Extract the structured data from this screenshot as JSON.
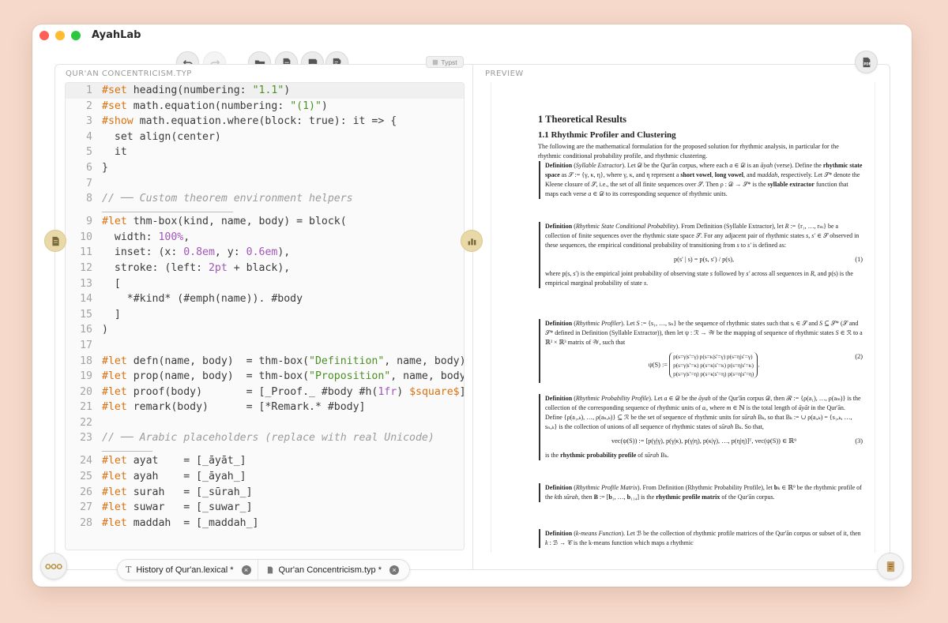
{
  "app": {
    "title": "AyahLab"
  },
  "toolbar": {
    "badge": "Typst"
  },
  "editor": {
    "label": "QUR'AN CONCENTRICISM.TYP",
    "lines": [
      {
        "n": "1",
        "code": [
          [
            "kw",
            "#set"
          ],
          [
            "",
            "heading(numbering: "
          ],
          [
            "str",
            "\"1.1\""
          ],
          [
            "",
            ")"
          ]
        ]
      },
      {
        "n": "2",
        "code": [
          [
            "kw",
            "#set"
          ],
          [
            "",
            "math.equation(numbering: "
          ],
          [
            "str",
            "\"(1)\""
          ],
          [
            "",
            ")"
          ]
        ]
      },
      {
        "n": "3",
        "code": [
          [
            "kw",
            "#show"
          ],
          [
            "",
            "math.equation.where(block: true): it => {"
          ]
        ]
      },
      {
        "n": "4",
        "code": [
          [
            "",
            "  set align(center)"
          ]
        ]
      },
      {
        "n": "5",
        "code": [
          [
            "",
            "  it"
          ]
        ]
      },
      {
        "n": "6",
        "code": [
          [
            "",
            "}"
          ]
        ]
      },
      {
        "n": "7",
        "code": []
      },
      {
        "n": "8",
        "code": [
          [
            "cmt",
            "// ── Custom theorem environment helpers"
          ]
        ],
        "rule": 166
      },
      {
        "n": "9",
        "code": [
          [
            "kw",
            "#let"
          ],
          [
            "",
            "thm-box(kind, name, body) = block("
          ]
        ]
      },
      {
        "n": "10",
        "code": [
          [
            "",
            "  width: "
          ],
          [
            "num",
            "100%"
          ],
          [
            "",
            ","
          ]
        ]
      },
      {
        "n": "11",
        "code": [
          [
            "",
            "  inset: (x: "
          ],
          [
            "num",
            "0.8em"
          ],
          [
            "",
            ", y: "
          ],
          [
            "num",
            "0.6em"
          ],
          [
            "",
            "),"
          ]
        ]
      },
      {
        "n": "12",
        "code": [
          [
            "",
            "  stroke: (left: "
          ],
          [
            "num",
            "2pt"
          ],
          [
            "",
            " + black),"
          ]
        ]
      },
      {
        "n": "13",
        "code": [
          [
            "",
            "  ["
          ]
        ]
      },
      {
        "n": "14",
        "code": [
          [
            "",
            "    *#kind* (#emph(name)). #body"
          ]
        ]
      },
      {
        "n": "15",
        "code": [
          [
            "",
            "  ]"
          ]
        ]
      },
      {
        "n": "16",
        "code": [
          [
            "",
            ")"
          ]
        ]
      },
      {
        "n": "17",
        "code": []
      },
      {
        "n": "18",
        "code": [
          [
            "kw",
            "#let"
          ],
          [
            "",
            "defn(name, body)  = thm-box("
          ],
          [
            "str",
            "\"Definition\""
          ],
          [
            "",
            ", name, body)"
          ]
        ]
      },
      {
        "n": "19",
        "code": [
          [
            "kw",
            "#let"
          ],
          [
            "",
            "prop(name, body)  = thm-box("
          ],
          [
            "str",
            "\"Proposition\""
          ],
          [
            "",
            ", name, body)"
          ]
        ]
      },
      {
        "n": "20",
        "code": [
          [
            "kw",
            "#let"
          ],
          [
            "",
            "proof(body)       = [_Proof._ #body #h("
          ],
          [
            "num",
            "1fr"
          ],
          [
            "",
            ") "
          ],
          [
            "kw",
            "$square$"
          ],
          [
            "",
            "]"
          ]
        ]
      },
      {
        "n": "21",
        "code": [
          [
            "kw",
            "#let"
          ],
          [
            "",
            "remark(body)      = [*Remark.* #body]"
          ]
        ]
      },
      {
        "n": "22",
        "code": []
      },
      {
        "n": "23",
        "code": [
          [
            "cmt",
            "// ── Arabic placeholders (replace with real Unicode)"
          ]
        ],
        "rule": 64
      },
      {
        "n": "24",
        "code": [
          [
            "kw",
            "#let"
          ],
          [
            "",
            "ayat    = [_āyāt_]"
          ]
        ]
      },
      {
        "n": "25",
        "code": [
          [
            "kw",
            "#let"
          ],
          [
            "",
            "ayah    = [_āyah_]"
          ]
        ]
      },
      {
        "n": "26",
        "code": [
          [
            "kw",
            "#let"
          ],
          [
            "",
            "surah   = [_sūrah_]"
          ]
        ]
      },
      {
        "n": "27",
        "code": [
          [
            "kw",
            "#let"
          ],
          [
            "",
            "suwar   = [_suwar_]"
          ]
        ]
      },
      {
        "n": "28",
        "code": [
          [
            "kw",
            "#let"
          ],
          [
            "",
            "maddah  = [_maddah_]"
          ]
        ]
      }
    ]
  },
  "preview": {
    "label": "PREVIEW",
    "h1": "1 Theoretical Results",
    "h2": "1.1 Rhythmic Profiler and Clustering",
    "intro": "The following are the mathematical formulation for the proposed solution for rhythmic analysis, in particular for the rhythmic conditional probability profile, and rhythmic clustering.",
    "d1": {
      "kind": "Definition",
      "name": "Syllable Extractor"
    },
    "d2": {
      "kind": "Definition",
      "name": "Rhythmic State Conditional Probability"
    },
    "d3": {
      "kind": "Definition",
      "name": "Rhythmic Profiler"
    },
    "d4": {
      "kind": "Definition",
      "name": "Rhythmic Probability Profile"
    },
    "d5": {
      "kind": "Definition",
      "name": "Rhythmic Profile Matrix"
    },
    "d6": {
      "kind": "Definition",
      "name": "k-means Function"
    }
  },
  "tabs": [
    {
      "icon": "text-icon",
      "label": "History of Qur'an.lexical *"
    },
    {
      "icon": "document-icon",
      "label": "Qur'an Concentricism.typ *"
    }
  ],
  "icons": [
    "undo-icon",
    "redo-icon",
    "open-folder-icon",
    "new-document-icon",
    "save-icon",
    "save-as-icon",
    "typst-icon",
    "pdf-icon",
    "document-icon",
    "chart-icon",
    "more-icon",
    "book-icon",
    "close-icon"
  ]
}
